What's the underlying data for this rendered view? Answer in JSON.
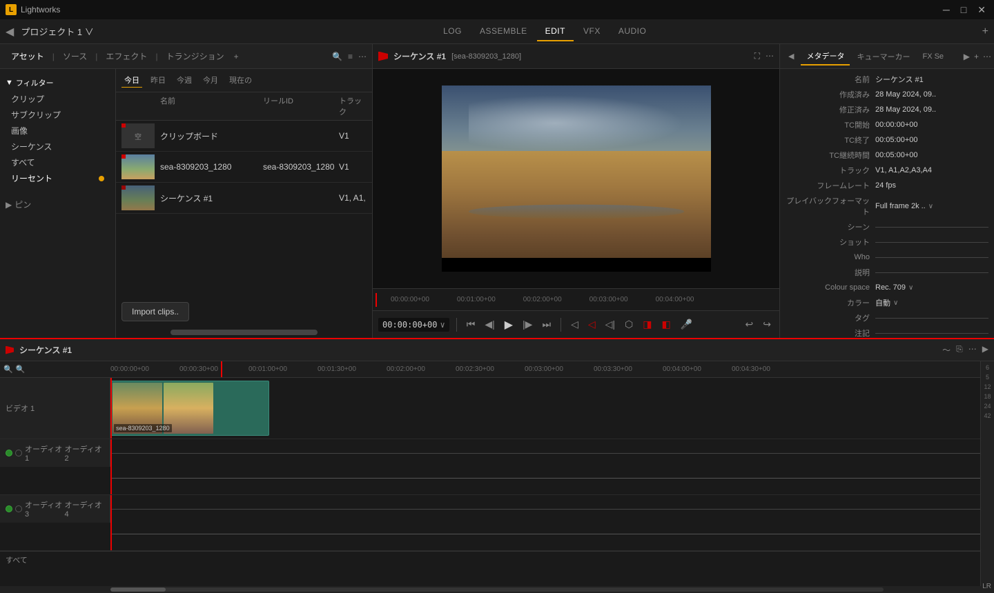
{
  "app": {
    "title": "Lightworks",
    "icon": "L"
  },
  "window_controls": {
    "minimize": "─",
    "maximize": "□",
    "close": "✕"
  },
  "menu": {
    "back": "◀",
    "project": "プロジェクト 1 ∨",
    "nav_items": [
      {
        "id": "log",
        "label": "LOG",
        "active": false
      },
      {
        "id": "assemble",
        "label": "ASSEMBLE",
        "active": false
      },
      {
        "id": "edit",
        "label": "EDIT",
        "active": true
      },
      {
        "id": "vfx",
        "label": "VFX",
        "active": false
      },
      {
        "id": "audio",
        "label": "AUDIO",
        "active": false
      }
    ],
    "add": "+"
  },
  "asset_panel": {
    "tabs": [
      {
        "label": "アセット",
        "active": true
      },
      {
        "label": "ソース",
        "active": false
      },
      {
        "label": "エフェクト",
        "active": false
      },
      {
        "label": "トランジション",
        "active": false
      }
    ],
    "add": "+",
    "search_icon": "🔍",
    "list_icon": "≡",
    "more_icon": "⋯"
  },
  "sidebar": {
    "filter_label": "フィルター",
    "items": [
      {
        "label": "クリップ"
      },
      {
        "label": "サブクリップ"
      },
      {
        "label": "画像"
      },
      {
        "label": "シーケンス"
      },
      {
        "label": "すべて"
      },
      {
        "label": "リーセント",
        "active": true,
        "dot": true
      }
    ],
    "pin": "ピン"
  },
  "file_list": {
    "date_tabs": [
      {
        "label": "今日",
        "active": true
      },
      {
        "label": "昨日"
      },
      {
        "label": "今週"
      },
      {
        "label": "今月"
      },
      {
        "label": "現在の"
      }
    ],
    "columns": {
      "name": "名前",
      "reel_id": "リールID",
      "track": "トラック"
    },
    "files": [
      {
        "id": "clipboard",
        "name": "クリップボード",
        "reel": "",
        "track": "V1",
        "type": "blank"
      },
      {
        "id": "sea",
        "name": "sea-8309203_1280",
        "reel": "sea-8309203_1280",
        "track": "V1",
        "type": "video"
      },
      {
        "id": "seq1",
        "name": "シーケンス #1",
        "reel": "",
        "track": "V1, A1,",
        "type": "sequence"
      }
    ]
  },
  "import_btn": "Import clips..",
  "preview": {
    "flag": "",
    "title": "シーケンス #1",
    "subtitle": "[sea-8309203_1280]",
    "fullscreen_icon": "⛶",
    "more_icon": "⋯",
    "timeline_marks": [
      "00:00:00+00",
      "00:01:00+00",
      "00:02:00+00",
      "00:03:00+00",
      "00:04:00+00"
    ],
    "timecode": "00:00:00+00",
    "controls": {
      "go_start": "⏮",
      "prev_frame": "◀",
      "play": "▶",
      "next_frame": "▶",
      "go_end": "⏭",
      "mark_in": "◁",
      "mark_out": "▷",
      "mark_clip": "▷|",
      "sync": "⬡",
      "trim_start": "◨",
      "trim_end": "◧",
      "audio": "🎤",
      "undo": "↩",
      "redo": "↪"
    }
  },
  "metadata": {
    "tabs": [
      {
        "label": "メタデータ",
        "active": true
      },
      {
        "label": "キューマーカー"
      },
      {
        "label": "FX Se",
        "active": false
      }
    ],
    "more_prev": "◀",
    "more_next": "▶",
    "add_tab": "+",
    "fields": [
      {
        "label": "名前",
        "value": "シーケンス #1"
      },
      {
        "label": "作成済み",
        "value": "28 May 2024, 09.."
      },
      {
        "label": "修正済み",
        "value": "28 May 2024, 09.."
      },
      {
        "label": "TC開始",
        "value": "00:00:00+00"
      },
      {
        "label": "TC終了",
        "value": "00:05:00+00"
      },
      {
        "label": "TC継続時間",
        "value": "00:05:00+00"
      },
      {
        "label": "トラック",
        "value": "V1, A1,A2,A3,A4"
      },
      {
        "label": "フレームレート",
        "value": "24 fps"
      },
      {
        "label": "プレイバックフォーマット",
        "value": "Full frame 2k ..",
        "dropdown": true
      },
      {
        "label": "シーン",
        "value": ""
      },
      {
        "label": "ショット",
        "value": ""
      },
      {
        "label": "Who",
        "value": ""
      },
      {
        "label": "説明",
        "value": ""
      },
      {
        "label": "Colour space",
        "value": "Rec. 709",
        "dropdown": true
      },
      {
        "label": "カラー",
        "value": "自動",
        "dropdown": true
      },
      {
        "label": "タグ",
        "value": ""
      },
      {
        "label": "注記",
        "value": ""
      }
    ]
  },
  "timeline": {
    "title": "シーケンス #1",
    "ruler_marks": [
      {
        "time": "00:00:00+00",
        "pos": 0
      },
      {
        "time": "00:00:30+00",
        "pos": 100
      },
      {
        "time": "00:01:00+00",
        "pos": 200
      },
      {
        "time": "00:01:30+00",
        "pos": 300
      },
      {
        "time": "00:02:00+00",
        "pos": 400
      },
      {
        "time": "00:02:30+00",
        "pos": 500
      },
      {
        "time": "00:03:00+00",
        "pos": 600
      },
      {
        "time": "00:03:30+00",
        "pos": 700
      },
      {
        "time": "00:04:00+00",
        "pos": 800
      },
      {
        "time": "00:04:30+00",
        "pos": 900
      }
    ],
    "tracks": [
      {
        "type": "video",
        "label": "ビデオ 1",
        "clip_label": "sea-8309203_1280"
      },
      {
        "type": "audio",
        "label": "オーディオ 1"
      },
      {
        "type": "audio",
        "label": "オーディオ 2"
      },
      {
        "type": "audio",
        "label": "オーディオ 3"
      },
      {
        "type": "audio",
        "label": "オーディオ 4"
      }
    ],
    "right_numbers": [
      "6",
      "5",
      "12",
      "18",
      "24",
      "42"
    ],
    "lr_label": "LR",
    "all_label": "すべて",
    "zoom_icons": [
      "🔍",
      "🔍"
    ]
  }
}
